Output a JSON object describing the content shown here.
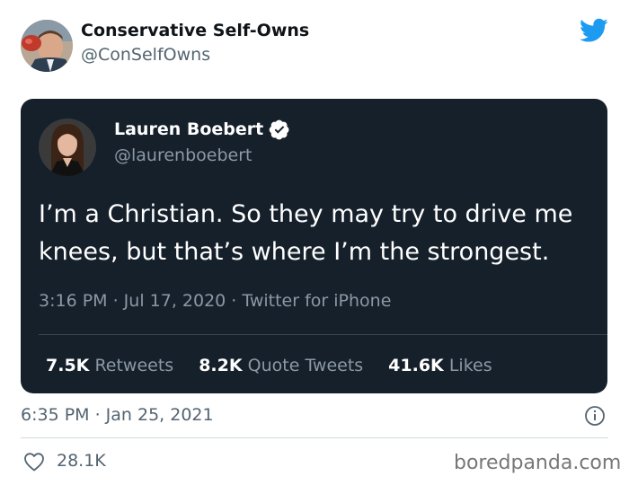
{
  "tweet": {
    "author_name": "Conservative Self-Owns",
    "author_handle": "@ConSelfOwns",
    "timestamp": "6:35 PM · Jan 25, 2021",
    "likes": "28.1K",
    "avatar_icon": "person-avatar",
    "logo_icon": "twitter-bird-icon",
    "info_icon": "info-icon",
    "heart_icon": "heart-icon"
  },
  "quoted_tweet": {
    "author_name": "Lauren Boebert",
    "author_handle": "@laurenboebert",
    "verified_icon": "verified-badge-icon",
    "text_lines": [
      "I’m a Christian. So they may try to drive me",
      "knees, but that’s where I’m the strongest."
    ],
    "meta": "3:16 PM · Jul 17, 2020 · Twitter for iPhone",
    "stats": [
      {
        "count": "7.5K",
        "label": "Retweets"
      },
      {
        "count": "8.2K",
        "label": "Quote Tweets"
      },
      {
        "count": "41.6K",
        "label": "Likes"
      }
    ]
  },
  "watermark": "boredpanda.com",
  "colors": {
    "twitter_blue": "#1d9bf0",
    "dark_card": "#15202b",
    "muted_text": "#536471",
    "dark_muted_text": "#8b98a5"
  }
}
